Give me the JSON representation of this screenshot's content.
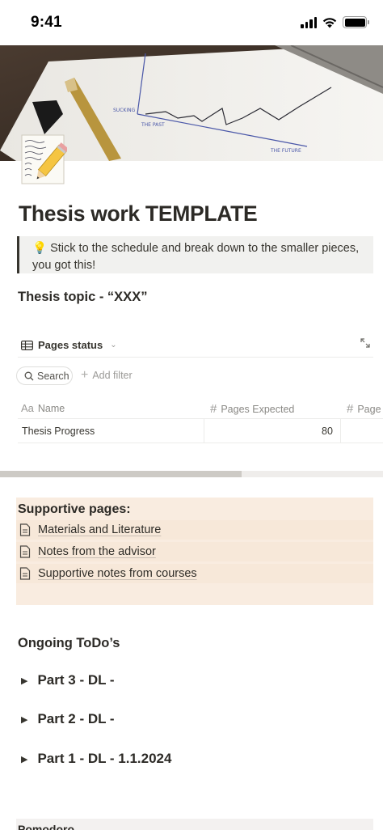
{
  "status_bar": {
    "time": "9:41"
  },
  "page": {
    "title": "Thesis work TEMPLATE",
    "callout_emoji": "💡",
    "callout_text": "Stick to the schedule and break down to the smaller pieces, you got this!",
    "topic_heading": "Thesis topic - “XXX”"
  },
  "database": {
    "view_name": "Pages status",
    "search_label": "Search",
    "add_filter_label": "Add filter",
    "columns": [
      {
        "label": "Name",
        "icon": "text-property-icon",
        "icon_glyph": "Aa"
      },
      {
        "label": "Pages Expected",
        "icon": "number-property-icon",
        "icon_glyph": "#"
      },
      {
        "label": "Page",
        "icon": "number-property-icon",
        "icon_glyph": "#"
      }
    ],
    "rows": [
      {
        "name": "Thesis Progress",
        "pages_expected": "80"
      }
    ],
    "horizontal_scroll_fraction": 0.63
  },
  "supportive": {
    "title": "Supportive pages:",
    "items": [
      {
        "label": "Materials and Literature"
      },
      {
        "label": "Notes from the advisor"
      },
      {
        "label": "Supportive notes from courses"
      }
    ]
  },
  "todos": {
    "heading": "Ongoing ToDo’s",
    "toggles": [
      {
        "label": "Part 3 - DL -"
      },
      {
        "label": "Part 2 - DL -"
      },
      {
        "label": "Part 1 - DL - 1.1.2024"
      }
    ]
  },
  "bottom": {
    "label": "Pomodoro"
  },
  "colors": {
    "callout_bg": "#f1f1ef",
    "supportive_bg": "#f9ece0",
    "text": "#37352f"
  }
}
